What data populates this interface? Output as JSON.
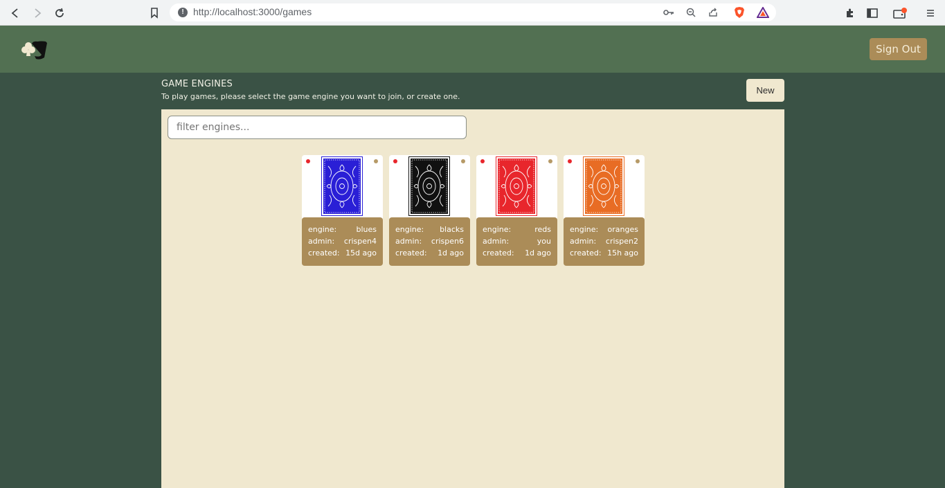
{
  "browser": {
    "url": "http://localhost:3000/games",
    "info_icon_glyph": "!"
  },
  "header": {
    "sign_out_label": "Sign Out"
  },
  "page": {
    "title": "GAME ENGINES",
    "subtitle": "To play games, please select the game engine you want to join, or create one.",
    "new_label": "New"
  },
  "filter": {
    "placeholder": "filter engines..."
  },
  "labels": {
    "engine": "engine:",
    "admin": "admin:",
    "created": "created:"
  },
  "engines": [
    {
      "engine": "blues",
      "admin": "crispen4",
      "created": "15d ago",
      "color": "#2a1fd6"
    },
    {
      "engine": "blacks",
      "admin": "crispen6",
      "created": "1d ago",
      "color": "#111111"
    },
    {
      "engine": "reds",
      "admin": "you",
      "created": "1d ago",
      "color": "#e8262c"
    },
    {
      "engine": "oranges",
      "admin": "crispen2",
      "created": "15h ago",
      "color": "#e86c24"
    }
  ],
  "colors": {
    "background": "#3a5245",
    "header": "#527052",
    "panel": "#f0e8cf",
    "accent": "#ab8c58"
  }
}
